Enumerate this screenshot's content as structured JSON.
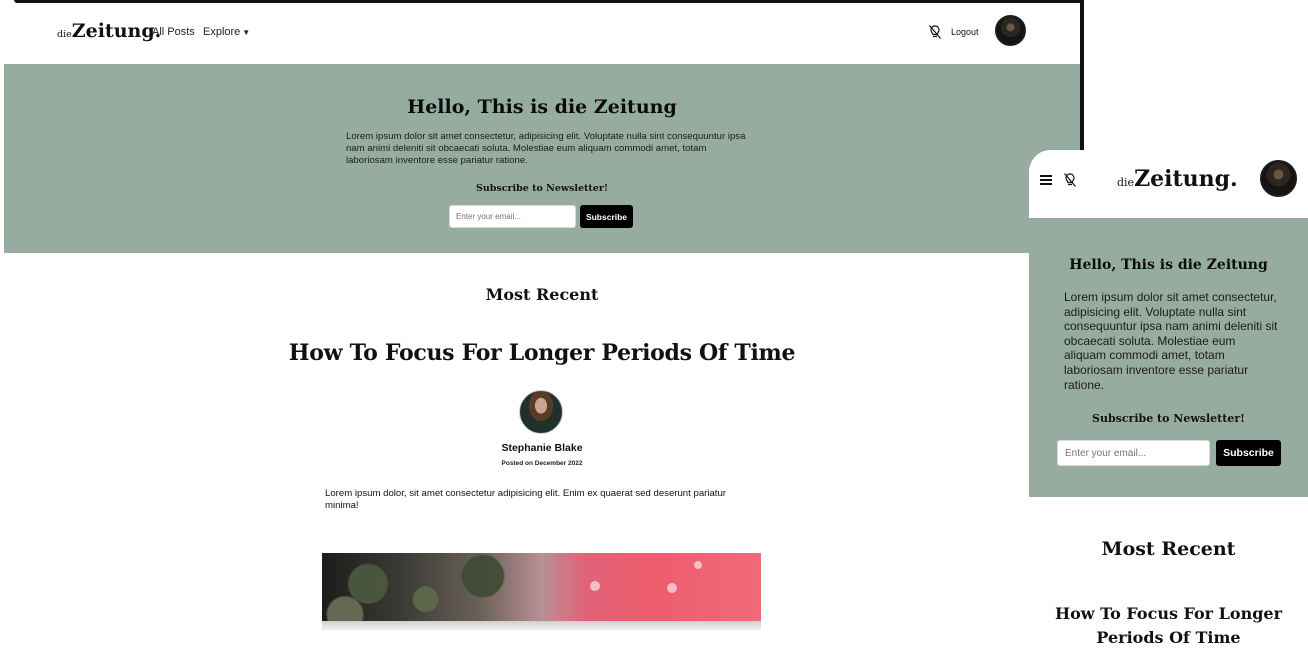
{
  "desktop": {
    "nav": {
      "brand_small": "die",
      "brand_main": "Zeitung.",
      "all_posts": "All Posts",
      "explore": "Explore",
      "logout": "Logout"
    },
    "hero": {
      "title": "Hello, This is die Zeitung",
      "text": "Lorem ipsum dolor sit amet consectetur, adipisicing elit. Voluptate nulla sint consequuntur ipsa nam animi deleniti sit obcaecati soluta. Molestiae eum aliquam commodi amet, totam laboriosam inventore esse pariatur ratione.",
      "subscribe_label": "Subscribe to Newsletter!",
      "email_placeholder": "Enter your email...",
      "subscribe_button": "Subscribe"
    },
    "section_title": "Most Recent",
    "post": {
      "title": "How To Focus For Longer Periods Of Time",
      "author": "Stephanie Blake",
      "posted": "Posted on December 2022",
      "excerpt": "Lorem ipsum dolor, sit amet consectetur adipisicing elit. Enim ex quaerat sed deserunt pariatur minima!"
    }
  },
  "mobile": {
    "brand_small": "die",
    "brand_main": "Zeitung.",
    "hero": {
      "title": "Hello, This is die Zeitung",
      "text": "Lorem ipsum dolor sit amet consectetur, adipisicing elit. Voluptate nulla sint consequuntur ipsa nam animi deleniti sit obcaecati soluta. Molestiae eum aliquam commodi amet, totam laboriosam inventore esse pariatur ratione.",
      "subscribe_label": "Subscribe to Newsletter!",
      "email_placeholder": "Enter your email...",
      "subscribe_button": "Subscribe"
    },
    "section_title": "Most Recent",
    "post_title": "How To Focus For Longer Periods Of Time"
  },
  "icons": {
    "theme_toggle": "bulb-off-icon",
    "menu": "hamburger-menu-icon",
    "dropdown": "chevron-down-icon"
  },
  "colors": {
    "hero_bg": "#97aca0",
    "button_bg": "#000000",
    "text": "#111111"
  }
}
